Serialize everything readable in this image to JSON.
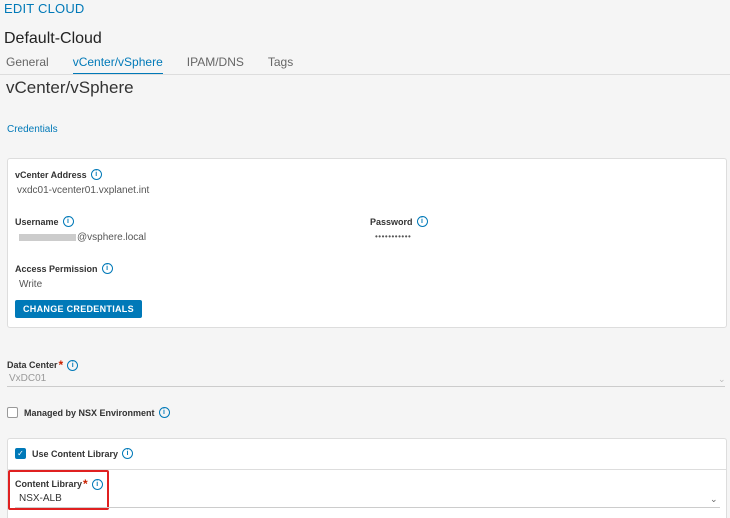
{
  "modal": {
    "title": "EDIT CLOUD",
    "cloud_name": "Default-Cloud"
  },
  "tabs": [
    {
      "label": "General",
      "active": false
    },
    {
      "label": "vCenter/vSphere",
      "active": true
    },
    {
      "label": "IPAM/DNS",
      "active": false
    },
    {
      "label": "Tags",
      "active": false
    }
  ],
  "section": {
    "title": "vCenter/vSphere",
    "credentials_link": "Credentials"
  },
  "credentials": {
    "vcenter_address_label": "vCenter Address",
    "vcenter_address_value": "vxdc01-vcenter01.vxplanet.int",
    "username_label": "Username",
    "username_value": "@vsphere.local",
    "password_label": "Password",
    "password_value": "•••••••••••",
    "access_permission_label": "Access Permission",
    "access_permission_value": "Write",
    "change_button": "CHANGE CREDENTIALS"
  },
  "data_center": {
    "label": "Data Center",
    "value": "VxDC01"
  },
  "managed_by_nsx": {
    "label": "Managed by NSX Environment",
    "checked": false
  },
  "content_library": {
    "use_label": "Use Content Library",
    "use_checked": true,
    "label": "Content Library",
    "value": "NSX-ALB"
  },
  "colors": {
    "accent": "#0079b8",
    "required": "#c92100",
    "highlight": "#e02020"
  }
}
